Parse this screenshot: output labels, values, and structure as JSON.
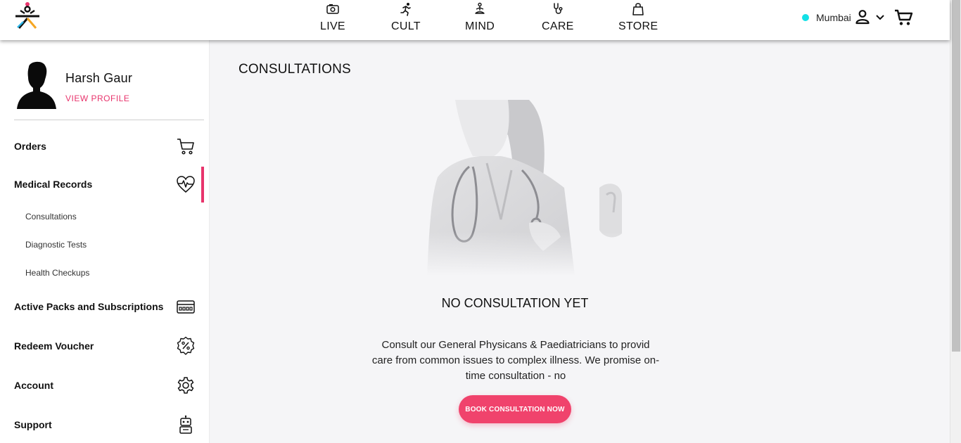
{
  "header": {
    "logo_icon": "cult-fit-logo-icon",
    "nav": [
      {
        "label": "LIVE",
        "icon": "live-camera-icon"
      },
      {
        "label": "CULT",
        "icon": "running-icon"
      },
      {
        "label": "MIND",
        "icon": "meditation-icon"
      },
      {
        "label": "CARE",
        "icon": "stethoscope-icon"
      },
      {
        "label": "STORE",
        "icon": "shopping-bag-icon"
      }
    ],
    "city": "Mumbai",
    "city_dot_color": "#13e0e6",
    "user_icon": "user-icon",
    "dropdown_icon": "chevron-down-icon",
    "cart_icon": "cart-icon"
  },
  "sidebar": {
    "profile": {
      "name": "Harsh Gaur",
      "view_profile": "VIEW PROFILE"
    },
    "menu": [
      {
        "label": "Orders",
        "icon": "cart-icon"
      },
      {
        "label": "Medical Records",
        "icon": "heart-pulse-icon",
        "active": true
      },
      {
        "label": "Active Packs and Subscriptions",
        "icon": "card-icon"
      },
      {
        "label": "Redeem Voucher",
        "icon": "voucher-percent-icon"
      },
      {
        "label": "Account",
        "icon": "gear-icon"
      },
      {
        "label": "Support",
        "icon": "robot-icon"
      }
    ],
    "submenu": [
      {
        "label": "Consultations"
      },
      {
        "label": "Diagnostic Tests"
      },
      {
        "label": "Health Checkups"
      }
    ],
    "accent_color": "#e8346c"
  },
  "main": {
    "title": "CONSULTATIONS",
    "empty_title": "NO CONSULTATION YET",
    "empty_desc": "Consult our General Physicans & Paediatricians to provid care from common issues to complex illness. We promise on-time consultation - no",
    "cta": "BOOK CONSULTATION NOW",
    "cta_color": "#f0436c"
  }
}
